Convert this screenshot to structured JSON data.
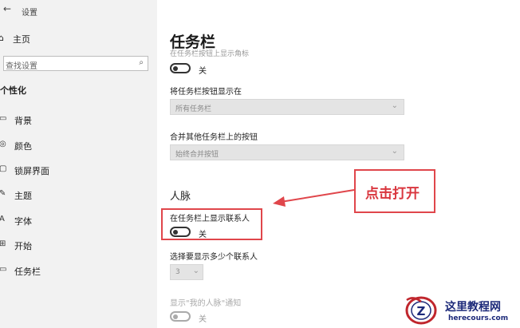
{
  "window": {
    "title": "设置",
    "back_glyph": "←"
  },
  "sidebar": {
    "home_label": "主页",
    "search_placeholder": "查找设置",
    "section_title": "个性化",
    "items": [
      {
        "label": "背景",
        "icon": "image-icon",
        "glyph": "▭"
      },
      {
        "label": "颜色",
        "icon": "palette-icon",
        "glyph": "◎"
      },
      {
        "label": "锁屏界面",
        "icon": "lock-screen-icon",
        "glyph": "▢"
      },
      {
        "label": "主题",
        "icon": "brush-icon",
        "glyph": "✎"
      },
      {
        "label": "字体",
        "icon": "font-icon",
        "glyph": "A"
      },
      {
        "label": "开始",
        "icon": "start-icon",
        "glyph": "⊞"
      },
      {
        "label": "任务栏",
        "icon": "taskbar-icon",
        "glyph": "▭"
      }
    ]
  },
  "main": {
    "title": "任务栏",
    "faded_top": "在任务栏按钮上显示角标",
    "toggle1": {
      "state": "关"
    },
    "combine_label": "将任务栏按钮显示在",
    "combine_value": "所有任务栏",
    "merge_label": "合并其他任务栏上的按钮",
    "merge_value": "始终合并按钮",
    "people_heading": "人脉",
    "people_toggle_label": "在任务栏上显示联系人",
    "people_toggle_state": "关",
    "count_label": "选择要显示多少个联系人",
    "count_value": "3",
    "notify_label": "显示\"我的人脉\"通知",
    "notify_state": "关"
  },
  "annotation": {
    "callout_text": "点击打开",
    "color": "#e0464b"
  },
  "watermark": {
    "cn": "这里教程网",
    "en": "herecours.com",
    "logo_letter": "Z"
  },
  "colors": {
    "sidebar_bg": "#f2f2f2",
    "accent_red": "#e0464b",
    "watermark_blue": "#1d2a7a"
  }
}
